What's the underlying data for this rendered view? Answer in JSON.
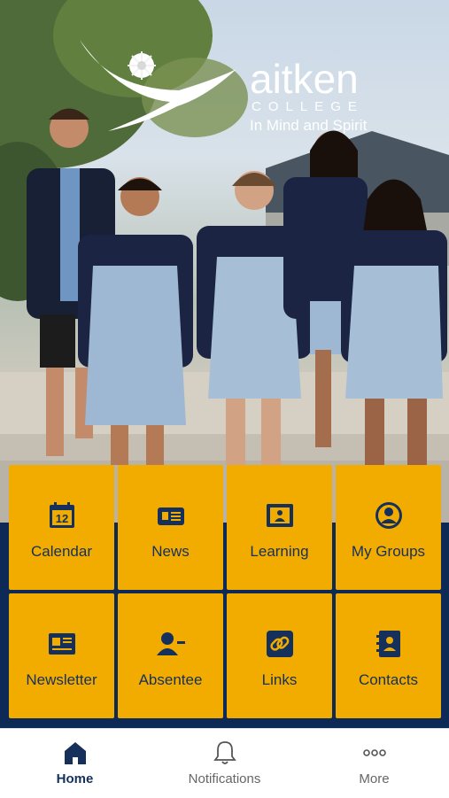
{
  "app": {
    "logo_wordmark": "aitken",
    "logo_college": "COLLEGE",
    "logo_tagline": "In Mind and Spirit"
  },
  "tiles": [
    {
      "label": "Calendar",
      "icon": "calendar-icon"
    },
    {
      "label": "News",
      "icon": "newspaper-icon"
    },
    {
      "label": "Learning",
      "icon": "learning-icon"
    },
    {
      "label": "My Groups",
      "icon": "groups-icon"
    },
    {
      "label": "Newsletter",
      "icon": "newsletter-icon"
    },
    {
      "label": "Absentee",
      "icon": "absentee-icon"
    },
    {
      "label": "Links",
      "icon": "link-icon"
    },
    {
      "label": "Contacts",
      "icon": "contacts-icon"
    }
  ],
  "calendar_day": "12",
  "tabbar": {
    "items": [
      {
        "label": "Home",
        "icon": "home-icon",
        "active": true
      },
      {
        "label": "Notifications",
        "icon": "bell-icon",
        "active": false
      },
      {
        "label": "More",
        "icon": "more-icon",
        "active": false
      }
    ]
  },
  "colors": {
    "tile_background": "#f2ac00",
    "navy": "#0d2a57",
    "label": "#16305c"
  }
}
